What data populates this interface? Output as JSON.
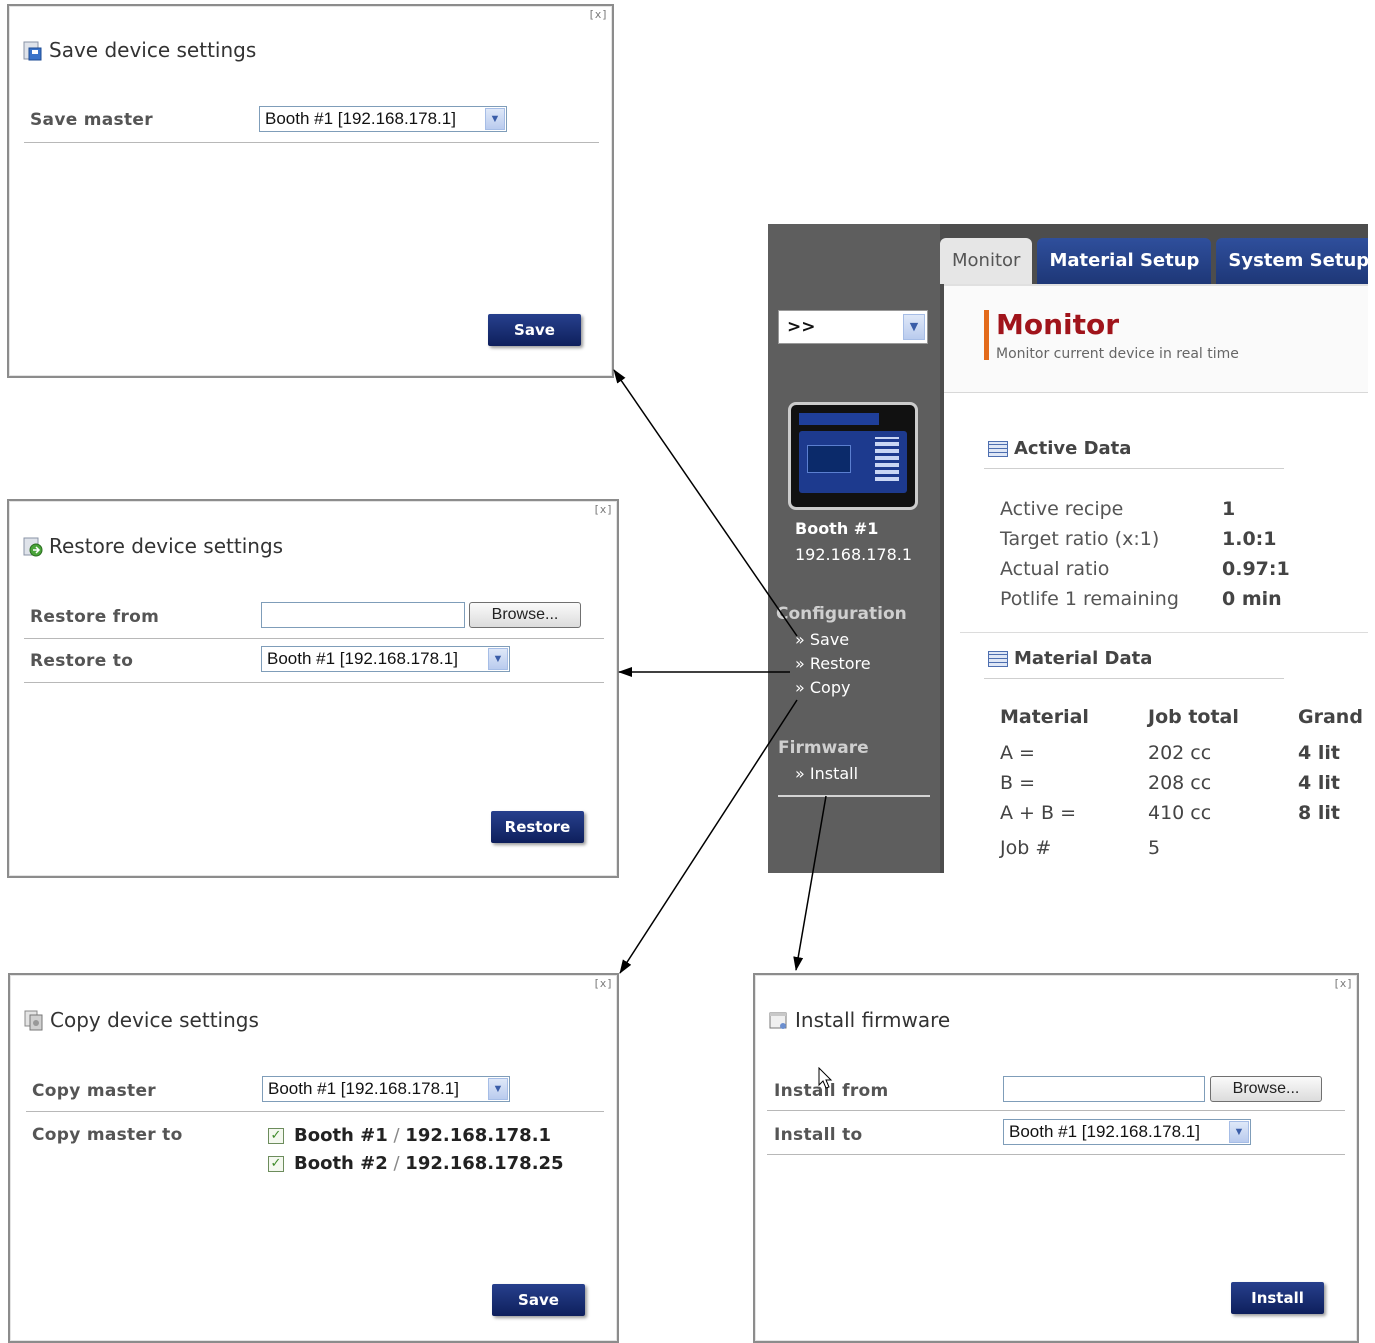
{
  "save_dialog": {
    "close": "[x]",
    "title": "Save device settings",
    "master_label": "Save master",
    "master_value": "Booth #1 [192.168.178.1]",
    "button": "Save"
  },
  "restore_dialog": {
    "close": "[x]",
    "title": "Restore device settings",
    "from_label": "Restore from",
    "browse": "Browse...",
    "to_label": "Restore to",
    "to_value": "Booth #1 [192.168.178.1]",
    "button": "Restore"
  },
  "copy_dialog": {
    "close": "[x]",
    "title": "Copy device settings",
    "master_label": "Copy master",
    "master_value": "Booth #1 [192.168.178.1]",
    "to_label": "Copy master to",
    "targets": [
      {
        "name": "Booth #1",
        "sep": "/",
        "ip": "192.168.178.1",
        "checked": true
      },
      {
        "name": "Booth #2",
        "sep": "/",
        "ip": "192.168.178.25",
        "checked": true
      }
    ],
    "button": "Save"
  },
  "install_dialog": {
    "close": "[x]",
    "title": "Install firmware",
    "from_label": "Install from",
    "browse": "Browse...",
    "to_label": "Install to",
    "to_value": "Booth #1 [192.168.178.1]",
    "button": "Install"
  },
  "app": {
    "tabs": [
      "Monitor",
      "Material Setup",
      "System Setup"
    ],
    "active_tab": "Monitor",
    "sidebar": {
      "selector": ">>",
      "device_name": "Booth #1",
      "device_ip": "192.168.178.1",
      "configuration_label": "Configuration",
      "config_links": [
        "» Save",
        "» Restore",
        "» Copy"
      ],
      "firmware_label": "Firmware",
      "firmware_links": [
        "» Install"
      ]
    },
    "monitor": {
      "title": "Monitor",
      "subtitle": "Monitor current device in real time",
      "active_data_title": "Active Data",
      "active_data": [
        {
          "label": "Active recipe",
          "value": "1"
        },
        {
          "label": "Target ratio (x:1)",
          "value": "1.0:1"
        },
        {
          "label": "Actual ratio",
          "value": "0.97:1"
        },
        {
          "label": "Potlife 1 remaining",
          "value": "0 min"
        }
      ],
      "material_data_title": "Material Data",
      "material_headers": [
        "Material",
        "Job total",
        "Grand t"
      ],
      "material_rows": [
        [
          "A =",
          "202 cc",
          "4 lit"
        ],
        [
          "B =",
          "208 cc",
          "4 lit"
        ],
        [
          "A + B =",
          "410 cc",
          "8 lit"
        ],
        [
          "Job #",
          "5",
          ""
        ]
      ]
    }
  },
  "colors": {
    "accent_orange": "#e36a1a",
    "title_red": "#a0141b",
    "tab_blue": "#2f4f9c",
    "button_navy": "#16296e",
    "sidebar_gray": "#5e5e5e"
  }
}
